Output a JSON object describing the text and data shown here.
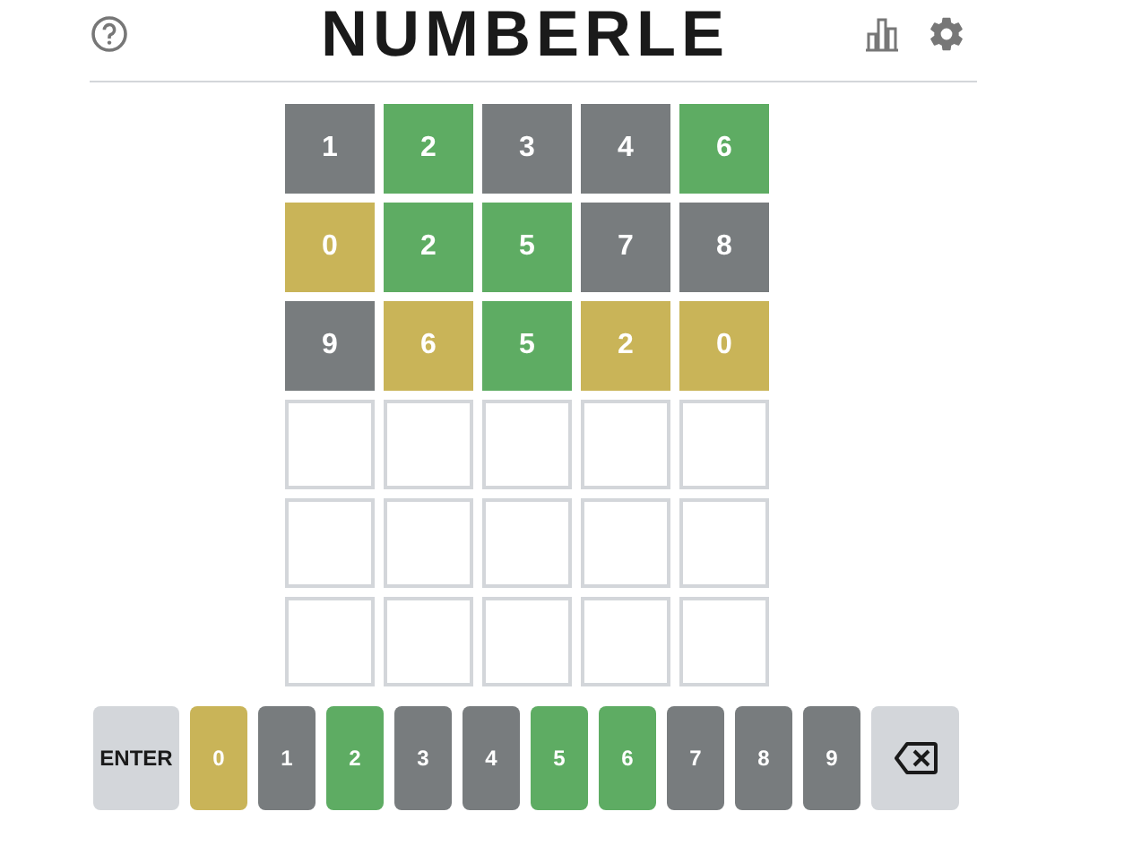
{
  "header": {
    "title": "NUMBERLE"
  },
  "board": [
    [
      {
        "kind": "filled",
        "digit": "1",
        "color": "#787c7e"
      },
      {
        "kind": "filled",
        "digit": "2",
        "color": "#5eac63"
      },
      {
        "kind": "filled",
        "digit": "3",
        "color": "#787c7e"
      },
      {
        "kind": "filled",
        "digit": "4",
        "color": "#787c7e"
      },
      {
        "kind": "filled",
        "digit": "6",
        "color": "#5eac63"
      }
    ],
    [
      {
        "kind": "filled",
        "digit": "0",
        "color": "#c9b458"
      },
      {
        "kind": "filled",
        "digit": "2",
        "color": "#5eac63"
      },
      {
        "kind": "filled",
        "digit": "5",
        "color": "#5eac63"
      },
      {
        "kind": "filled",
        "digit": "7",
        "color": "#787c7e"
      },
      {
        "kind": "filled",
        "digit": "8",
        "color": "#787c7e"
      }
    ],
    [
      {
        "kind": "filled",
        "digit": "9",
        "color": "#787c7e"
      },
      {
        "kind": "filled",
        "digit": "6",
        "color": "#c9b458"
      },
      {
        "kind": "filled",
        "digit": "5",
        "color": "#5eac63"
      },
      {
        "kind": "filled",
        "digit": "2",
        "color": "#c9b458"
      },
      {
        "kind": "filled",
        "digit": "0",
        "color": "#c9b458"
      }
    ],
    [
      {
        "kind": "empty"
      },
      {
        "kind": "empty"
      },
      {
        "kind": "empty"
      },
      {
        "kind": "empty"
      },
      {
        "kind": "empty"
      }
    ],
    [
      {
        "kind": "empty"
      },
      {
        "kind": "empty"
      },
      {
        "kind": "empty"
      },
      {
        "kind": "empty"
      },
      {
        "kind": "empty"
      }
    ],
    [
      {
        "kind": "empty"
      },
      {
        "kind": "empty"
      },
      {
        "kind": "empty"
      },
      {
        "kind": "empty"
      },
      {
        "kind": "empty"
      }
    ]
  ],
  "keyboard": [
    {
      "kind": "enter",
      "label": "ENTER",
      "color": "#d3d6da"
    },
    {
      "kind": "digit",
      "label": "0",
      "color": "#c9b458"
    },
    {
      "kind": "digit",
      "label": "1",
      "color": "#787c7e"
    },
    {
      "kind": "digit",
      "label": "2",
      "color": "#5eac63"
    },
    {
      "kind": "digit",
      "label": "3",
      "color": "#787c7e"
    },
    {
      "kind": "digit",
      "label": "4",
      "color": "#787c7e"
    },
    {
      "kind": "digit",
      "label": "5",
      "color": "#5eac63"
    },
    {
      "kind": "digit",
      "label": "6",
      "color": "#5eac63"
    },
    {
      "kind": "digit",
      "label": "7",
      "color": "#787c7e"
    },
    {
      "kind": "digit",
      "label": "8",
      "color": "#787c7e"
    },
    {
      "kind": "digit",
      "label": "9",
      "color": "#787c7e"
    },
    {
      "kind": "backspace",
      "color": "#d3d6da"
    }
  ]
}
